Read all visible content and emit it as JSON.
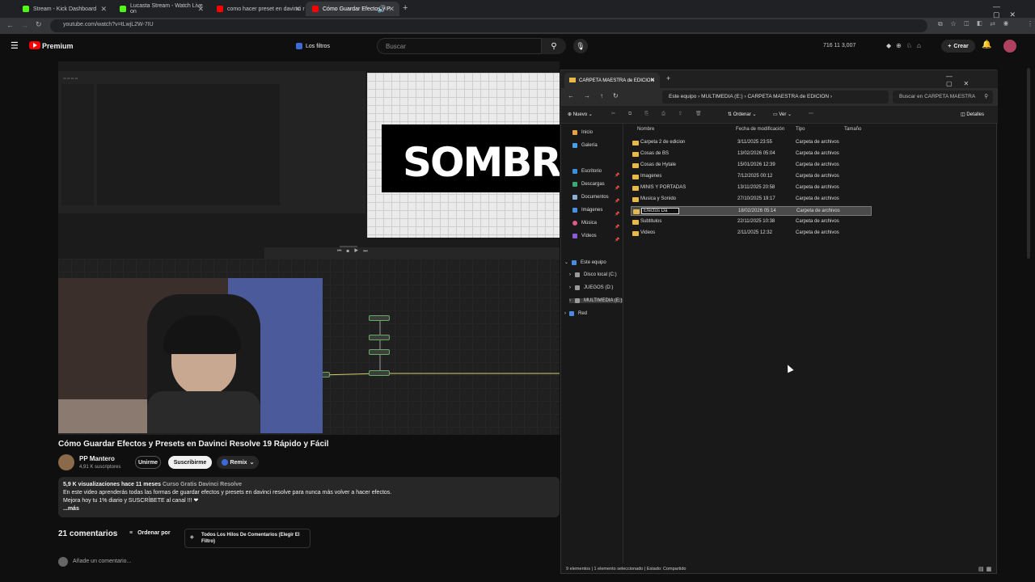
{
  "browser": {
    "tabs": [
      {
        "title": "Stream - Kick Dashboard",
        "color": "#53fc18",
        "active": false
      },
      {
        "title": "Lucasta Stream - Watch Live on",
        "color": "#53fc18",
        "active": false
      },
      {
        "title": "como hacer preset en davinci r",
        "color": "#ff0000",
        "active": false
      },
      {
        "title": "Cómo Guardar Efectos y P",
        "color": "#ff0000",
        "active": true
      }
    ],
    "url": "youtube.com/watch?v=tLwjL2W-7IU"
  },
  "youtube": {
    "logo_label": "Premium",
    "filters_label": "Los filtros",
    "search_placeholder": "Buscar",
    "stats": "716   11   3,007",
    "create_label": "Crear",
    "video": {
      "overlay_text": "SOMBR",
      "title": "Cómo Guardar Efectos y Presets en Davinci Resolve 19 Rápido y Fácil",
      "channel": "PP Mantero",
      "subscribers": "4,91 K suscriptores",
      "join_label": "Unirme",
      "subscribe_label": "Suscribirme",
      "remix_label": "Remix",
      "views_line": "5,9 K visualizaciones  hace 11 meses",
      "course_link": "Curso Gratis Davinci Resolve",
      "desc_line1": "En este video aprenderás todas las formas de guardar efectos y presets en davinci resolve para nunca más volver a hacer efectos.",
      "desc_line2": "Mejora hoy tu 1% diario y SUSCRÍBETE al canal !!! ❤",
      "more_label": "...más"
    },
    "comments": {
      "count": "21 comentarios",
      "sort_label": "Ordenar por",
      "threads_label": "Todos Los Hilos De Comentarios (Elegir El Filtro)",
      "add_placeholder": "Añade un comentario..."
    }
  },
  "explorer": {
    "tab_title": "CARPETA MAESTRA de EDICION",
    "breadcrumb": [
      "Este equipo",
      "MULTIMEDIA (E:)",
      "CARPETA MAESTRA de EDICION"
    ],
    "search_placeholder": "Buscar en CARPETA MAESTRA",
    "toolbar": {
      "new": "Nuevo",
      "sort": "Ordenar",
      "view": "Ver",
      "details": "Detalles"
    },
    "nav": {
      "quick": [
        "Inicio",
        "Galería"
      ],
      "pinned": [
        "Escritorio",
        "Descargas",
        "Documentos",
        "Imágenes",
        "Música",
        "Vídeos"
      ],
      "pc": "Este equipo",
      "drives": [
        "Disco local (C:)",
        "JUEGOS (D:)",
        "MULTIMEDIA (E:)"
      ],
      "network": "Red"
    },
    "columns": {
      "name": "Nombre",
      "modified": "Fecha de modificación",
      "type": "Tipo",
      "size": "Tamaño"
    },
    "files": [
      {
        "name": "Carpeta 2 de edicion",
        "date": "3/11/2025 23:55",
        "type": "Carpeta de archivos"
      },
      {
        "name": "Cosas de BS",
        "date": "13/02/2026 05:04",
        "type": "Carpeta de archivos"
      },
      {
        "name": "Cosas de Hytale",
        "date": "15/01/2026 12:39",
        "type": "Carpeta de archivos"
      },
      {
        "name": "Imagenes",
        "date": "7/12/2025 00:12",
        "type": "Carpeta de archivos"
      },
      {
        "name": "MINIS Y PORTADAS",
        "date": "13/11/2025 20:58",
        "type": "Carpeta de archivos"
      },
      {
        "name": "Musica y Sonido",
        "date": "27/10/2025 19:17",
        "type": "Carpeta de archivos"
      },
      {
        "name": "Efectos Da",
        "date": "18/02/2026 05:14",
        "type": "Carpeta de archivos"
      },
      {
        "name": "Subtitulos",
        "date": "22/11/2025 10:38",
        "type": "Carpeta de archivos"
      },
      {
        "name": "Videos",
        "date": "2/11/2025 12:32",
        "type": "Carpeta de archivos"
      }
    ],
    "status": {
      "items": "9 elementos",
      "selected": "1 elemento seleccionado",
      "state": "Estado:",
      "shared": "Compartido"
    }
  }
}
